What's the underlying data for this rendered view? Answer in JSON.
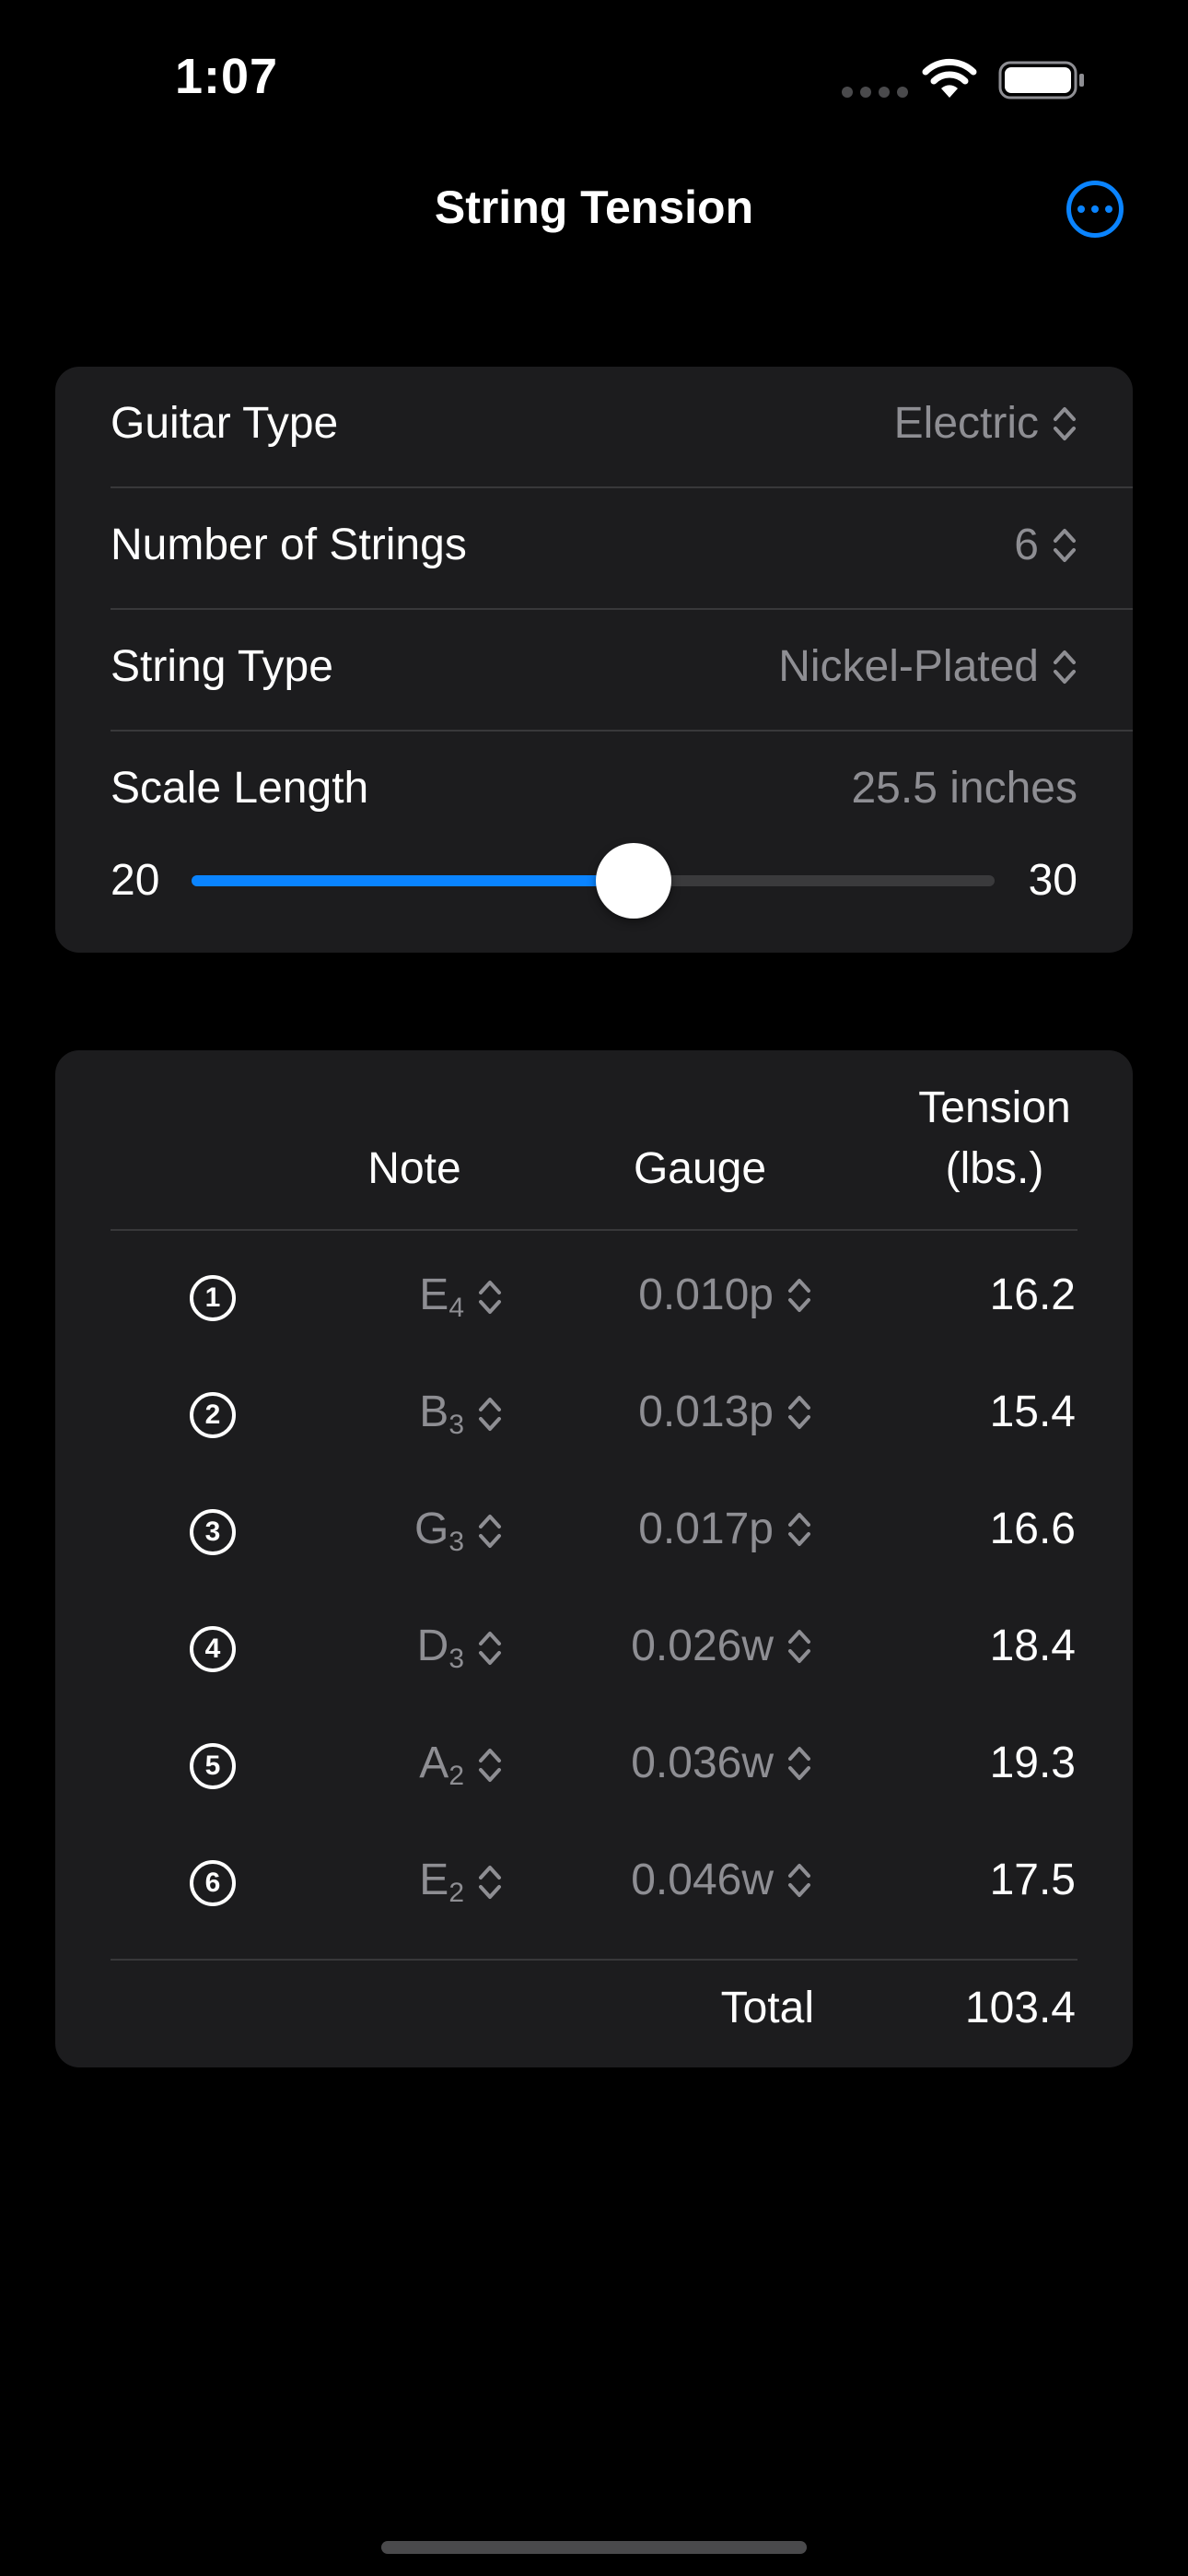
{
  "status_bar": {
    "time": "1:07"
  },
  "nav": {
    "title": "String Tension"
  },
  "settings": {
    "guitar_type": {
      "label": "Guitar Type",
      "value": "Electric"
    },
    "num_strings": {
      "label": "Number of Strings",
      "value": "6"
    },
    "string_type": {
      "label": "String Type",
      "value": "Nickel-Plated"
    },
    "scale_length": {
      "label": "Scale Length",
      "value": "25.5 inches",
      "min": "20",
      "max": "30",
      "level": 25.5
    }
  },
  "table": {
    "headers": {
      "note": "Note",
      "gauge": "Gauge",
      "tension_line1": "Tension",
      "tension_line2": "(lbs.)"
    },
    "rows": [
      {
        "num": "1",
        "note": "E",
        "octave": "4",
        "gauge": "0.010p",
        "tension": "16.2"
      },
      {
        "num": "2",
        "note": "B",
        "octave": "3",
        "gauge": "0.013p",
        "tension": "15.4"
      },
      {
        "num": "3",
        "note": "G",
        "octave": "3",
        "gauge": "0.017p",
        "tension": "16.6"
      },
      {
        "num": "4",
        "note": "D",
        "octave": "3",
        "gauge": "0.026w",
        "tension": "18.4"
      },
      {
        "num": "5",
        "note": "A",
        "octave": "2",
        "gauge": "0.036w",
        "tension": "19.3"
      },
      {
        "num": "6",
        "note": "E",
        "octave": "2",
        "gauge": "0.046w",
        "tension": "17.5"
      }
    ],
    "total_label": "Total",
    "total_value": "103.4"
  },
  "colors": {
    "accent": "#0a84ff",
    "card": "#1c1c1e",
    "secondary_text": "#8e8e93"
  }
}
